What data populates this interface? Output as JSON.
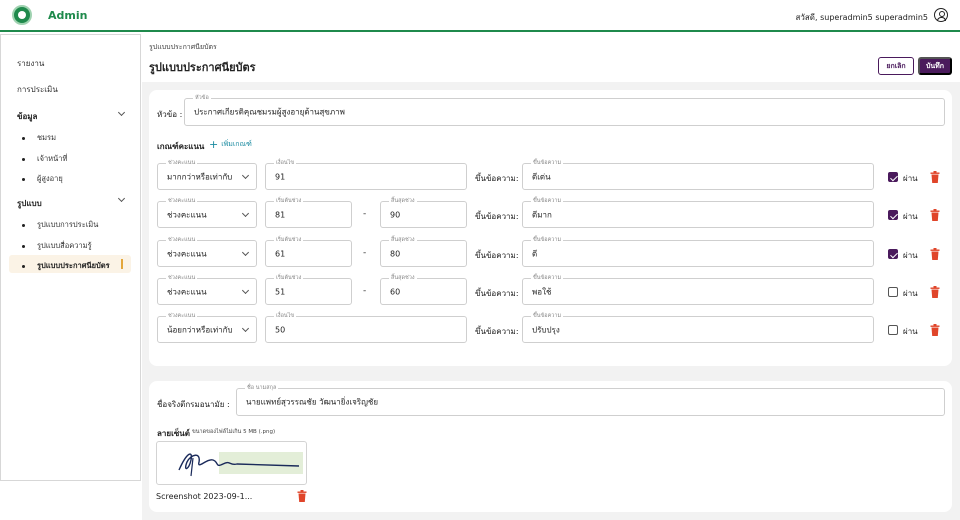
{
  "app": {
    "brand": "Admin",
    "user_greeting": "สวัสดี, superadmin5 superadmin5"
  },
  "sidebar": {
    "items": [
      {
        "label": "รายงาน"
      },
      {
        "label": "การประเมิน"
      }
    ],
    "groups": [
      {
        "label": "ข้อมูล",
        "children": [
          "ชมรม",
          "เจ้าหน้าที่",
          "ผู้สูงอายุ"
        ]
      },
      {
        "label": "รูปแบบ",
        "children": [
          "รูปแบบการประเมิน",
          "รูปแบบสื่อความรู้",
          "รูปแบบประกาศนียบัตร"
        ]
      }
    ]
  },
  "header": {
    "breadcrumb": "รูปแบบประกาศนียบัตร",
    "title": "รูปแบบประกาศนียบัตร",
    "cancel_label": "ยกเลิก",
    "save_label": "บันทึก"
  },
  "topic": {
    "label": "หัวข้อ :",
    "field_label": "หัวข้อ",
    "value": "ประกาศเกียรติคุณชมรมผู้สูงอายุด้านสุขภาพ"
  },
  "criteria": {
    "title": "เกณฑ์คะแนน",
    "add_label": "เพิ่มเกณฑ์",
    "range_label": "ช่วงคะแนน",
    "condition_label": "เงื่อนไข",
    "start_label": "เริ่มต้นช่วง",
    "end_label": "สิ้นสุดช่วง",
    "message_label": "ขึ้นข้อความ:",
    "message_field_label": "ขึ้นข้อความ",
    "pass_label": "ผ่าน",
    "rows": [
      {
        "type": "มากกว่าหรือเท่ากับ",
        "condition": "91",
        "message": "ดีเด่น",
        "passed": true
      },
      {
        "type": "ช่วงคะแนน",
        "start": "81",
        "end": "90",
        "message": "ดีมาก",
        "passed": true
      },
      {
        "type": "ช่วงคะแนน",
        "start": "61",
        "end": "80",
        "message": "ดี",
        "passed": true
      },
      {
        "type": "ช่วงคะแนน",
        "start": "51",
        "end": "60",
        "message": "พอใช้",
        "passed": false
      },
      {
        "type": "น้อยกว่าหรือเท่ากับ",
        "condition": "50",
        "message": "ปรับปรุง",
        "passed": false
      }
    ]
  },
  "signer": {
    "label": "ชื่อจริงตีกรมอนามัย :",
    "field_label": "ชื่อ นามสกุล",
    "value": "นายแพทย์สุวรรณชัย วัฒนายิ่งเจริญชัย",
    "sig_title": "ลายเซ็นต์",
    "sig_note": "ขนาดของไฟล์ไม่เกิน 5 MB (.png)",
    "file_name": "Screenshot 2023-09-1..."
  },
  "colors": {
    "brand": "#1f8a4c",
    "primary": "#4a1a5c",
    "danger": "#e0452a",
    "link": "#1a8aa0"
  }
}
